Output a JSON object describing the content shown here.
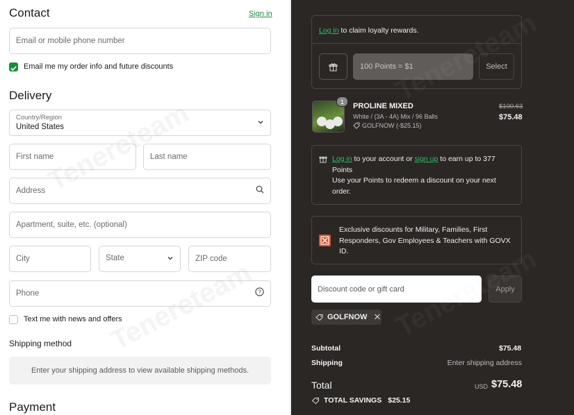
{
  "contact": {
    "heading": "Contact",
    "sign_in": "Sign in",
    "email_placeholder": "Email or mobile phone number",
    "email_offers": "Email me my order info and future discounts"
  },
  "delivery": {
    "heading": "Delivery",
    "country_label": "Country/Region",
    "country_value": "United States",
    "first_name": "First name",
    "last_name": "Last name",
    "address": "Address",
    "apartment": "Apartment, suite, etc. (optional)",
    "city": "City",
    "state": "State",
    "zip": "ZIP code",
    "phone": "Phone",
    "text_offers": "Text me with news and offers"
  },
  "shipping": {
    "heading": "Shipping method",
    "notice": "Enter your shipping address to view available shipping methods."
  },
  "payment": {
    "heading": "Payment"
  },
  "loyalty": {
    "login": "Log in",
    "claim": " to claim loyalty rewards.",
    "points_option": "100 Points = $1",
    "select": "Select"
  },
  "item": {
    "quantity": "1",
    "name": "PROLINE MIXED",
    "variant": "White / (3A - 4A) Mix / 96 Balls",
    "discount": "GOLFNOW (-$25.15)",
    "original_price": "$100.63",
    "price": "$75.48"
  },
  "earn": {
    "login": "Log in",
    "mid": " to your account or ",
    "signup": "sign up",
    "tail": " to earn up to 377",
    "points": "Points",
    "sub": "Use your Points to redeem a discount on your next order."
  },
  "govx": {
    "text": "Exclusive discounts for Military, Families, First Responders, Gov Employees & Teachers with GOVX ID."
  },
  "discount": {
    "placeholder": "Discount code or gift card",
    "apply": "Apply",
    "applied_code": "GOLFNOW"
  },
  "summary": {
    "subtotal_label": "Subtotal",
    "subtotal_value": "$75.48",
    "shipping_label": "Shipping",
    "shipping_value": "Enter shipping address",
    "total_label": "Total",
    "currency": "USD",
    "total_value": "$75.48",
    "savings_label": "TOTAL SAVINGS",
    "savings_value": "$25.15"
  },
  "watermark": "Tenereteam",
  "colors": {
    "accent": "#1a8f3c",
    "panel": "#2b2725",
    "link_dark": "#2bbf6a"
  }
}
